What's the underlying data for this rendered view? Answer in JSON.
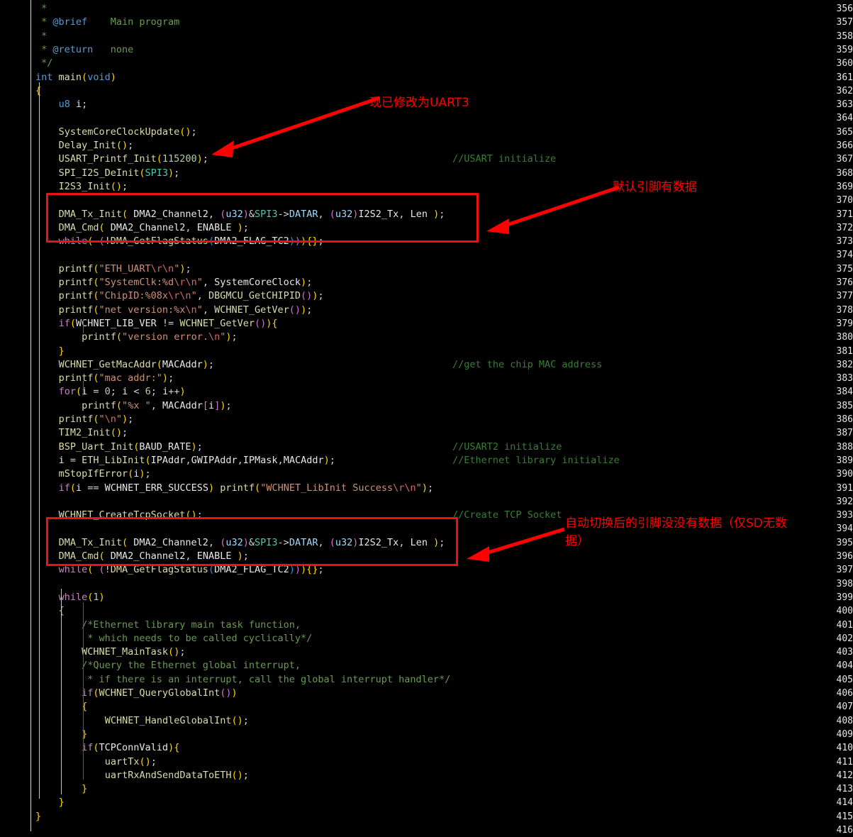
{
  "editor": {
    "first_line": 356,
    "last_line": 416,
    "language": "c",
    "background": "#000000",
    "gutter_color": "#e6e6e6"
  },
  "lines": [
    {
      "n": 356,
      "text": " *"
    },
    {
      "n": 357,
      "text": " * @brief    Main program"
    },
    {
      "n": 358,
      "text": " *"
    },
    {
      "n": 359,
      "text": " * @return   none"
    },
    {
      "n": 360,
      "text": " */"
    },
    {
      "n": 361,
      "text": "int main(void)"
    },
    {
      "n": 362,
      "text": "{"
    },
    {
      "n": 363,
      "text": "    u8 i;"
    },
    {
      "n": 364,
      "text": ""
    },
    {
      "n": 365,
      "text": "    SystemCoreClockUpdate();"
    },
    {
      "n": 366,
      "text": "    Delay_Init();"
    },
    {
      "n": 367,
      "text": "    USART_Printf_Init(115200);",
      "comment": "//USART initialize"
    },
    {
      "n": 368,
      "text": "    SPI_I2S_DeInit(SPI3);"
    },
    {
      "n": 369,
      "text": "    I2S3_Init();"
    },
    {
      "n": 370,
      "text": ""
    },
    {
      "n": 371,
      "text": "    DMA_Tx_Init( DMA2_Channel2, (u32)&SPI3->DATAR, (u32)I2S2_Tx, Len );"
    },
    {
      "n": 372,
      "text": "    DMA_Cmd( DMA2_Channel2, ENABLE );"
    },
    {
      "n": 373,
      "text": "    while( (!DMA_GetFlagStatus(DMA2_FLAG_TC2))){};"
    },
    {
      "n": 374,
      "text": ""
    },
    {
      "n": 375,
      "text": "    printf(\"ETH_UART\\r\\n\");"
    },
    {
      "n": 376,
      "text": "    printf(\"SystemClk:%d\\r\\n\", SystemCoreClock);"
    },
    {
      "n": 377,
      "text": "    printf(\"ChipID:%08x\\r\\n\", DBGMCU_GetCHIPID());"
    },
    {
      "n": 378,
      "text": "    printf(\"net version:%x\\n\", WCHNET_GetVer());"
    },
    {
      "n": 379,
      "text": "    if(WCHNET_LIB_VER != WCHNET_GetVer()){"
    },
    {
      "n": 380,
      "text": "        printf(\"version error.\\n\");"
    },
    {
      "n": 381,
      "text": "    }"
    },
    {
      "n": 382,
      "text": "    WCHNET_GetMacAddr(MACAddr);",
      "comment": "//get the chip MAC address"
    },
    {
      "n": 383,
      "text": "    printf(\"mac addr:\");"
    },
    {
      "n": 384,
      "text": "    for(i = 0; i < 6; i++)"
    },
    {
      "n": 385,
      "text": "        printf(\"%x \", MACAddr[i]);"
    },
    {
      "n": 386,
      "text": "    printf(\"\\n\");"
    },
    {
      "n": 387,
      "text": "    TIM2_Init();"
    },
    {
      "n": 388,
      "text": "    BSP_Uart_Init(BAUD_RATE);",
      "comment": "//USART2 initialize"
    },
    {
      "n": 389,
      "text": "    i = ETH_LibInit(IPAddr,GWIPAddr,IPMask,MACAddr);",
      "comment": "//Ethernet library initialize"
    },
    {
      "n": 390,
      "text": "    mStopIfError(i);"
    },
    {
      "n": 391,
      "text": "    if(i == WCHNET_ERR_SUCCESS) printf(\"WCHNET_LibInit Success\\r\\n\");"
    },
    {
      "n": 392,
      "text": ""
    },
    {
      "n": 393,
      "text": "    WCHNET_CreateTcpSocket();",
      "comment": "//Create TCP Socket"
    },
    {
      "n": 394,
      "text": ""
    },
    {
      "n": 395,
      "text": "    DMA_Tx_Init( DMA2_Channel2, (u32)&SPI3->DATAR, (u32)I2S2_Tx, Len );"
    },
    {
      "n": 396,
      "text": "    DMA_Cmd( DMA2_Channel2, ENABLE );"
    },
    {
      "n": 397,
      "text": "    while( (!DMA_GetFlagStatus(DMA2_FLAG_TC2))){};"
    },
    {
      "n": 398,
      "text": ""
    },
    {
      "n": 399,
      "text": "    while(1)"
    },
    {
      "n": 400,
      "text": "    {"
    },
    {
      "n": 401,
      "text": "        /*Ethernet library main task function,"
    },
    {
      "n": 402,
      "text": "         * which needs to be called cyclically*/"
    },
    {
      "n": 403,
      "text": "        WCHNET_MainTask();"
    },
    {
      "n": 404,
      "text": "        /*Query the Ethernet global interrupt,"
    },
    {
      "n": 405,
      "text": "         * if there is an interrupt, call the global interrupt handler*/"
    },
    {
      "n": 406,
      "text": "        if(WCHNET_QueryGlobalInt())"
    },
    {
      "n": 407,
      "text": "        {"
    },
    {
      "n": 408,
      "text": "            WCHNET_HandleGlobalInt();"
    },
    {
      "n": 409,
      "text": "        }"
    },
    {
      "n": 410,
      "text": "        if(TCPConnValid){"
    },
    {
      "n": 411,
      "text": "            uartTx();"
    },
    {
      "n": 412,
      "text": "            uartRxAndSendDataToETH();"
    },
    {
      "n": 413,
      "text": "        }"
    },
    {
      "n": 414,
      "text": "    }"
    },
    {
      "n": 415,
      "text": "}"
    },
    {
      "n": 416,
      "text": ""
    }
  ],
  "annotations": [
    {
      "id": "anno-uart3",
      "text": "现已修改为UART3",
      "color": "#ff0000",
      "target_line": 367
    },
    {
      "id": "anno-default-pin",
      "text": "默认引脚有数据",
      "color": "#ff0000",
      "target_line": 373
    },
    {
      "id": "anno-auto-switch",
      "text": "自动切换后的引脚没没有数据（仅SD无数\n据）",
      "color": "#ff0000",
      "target_line": 396
    }
  ],
  "highlight_boxes": [
    {
      "id": "box-dma-first",
      "color": "#ee1111",
      "lines": [
        371,
        373
      ]
    },
    {
      "id": "box-dma-second",
      "color": "#ee1111",
      "lines": [
        395,
        397
      ]
    }
  ]
}
